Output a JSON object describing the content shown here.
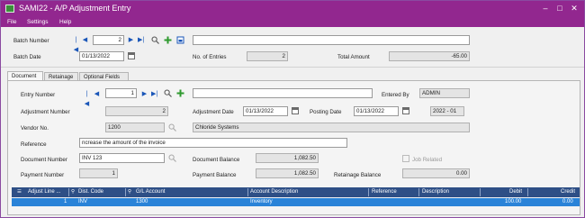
{
  "window": {
    "title": "SAMI22 - A/P Adjustment Entry",
    "controls": [
      "–",
      "□",
      "✕"
    ]
  },
  "menu": [
    "File",
    "Settings",
    "Help"
  ],
  "batch": {
    "number_label": "Batch Number",
    "number_value": "2",
    "date_label": "Batch Date",
    "date_value": "01/13/2022",
    "description_value": "",
    "entries_label": "No. of Entries",
    "entries_value": "2",
    "total_label": "Total Amount",
    "total_value": "-65.00"
  },
  "tabs": [
    "Document",
    "Retainage",
    "Optional Fields"
  ],
  "entry": {
    "entry_number_label": "Entry Number",
    "entry_number_value": "1",
    "entry_description_value": "",
    "entered_by_label": "Entered By",
    "entered_by_value": "ADMIN",
    "adjustment_number_label": "Adjustment Number",
    "adjustment_number_value": "2",
    "adjustment_date_label": "Adjustment Date",
    "adjustment_date_value": "01/13/2022",
    "posting_date_label": "Posting Date",
    "posting_date_value": "01/13/2022",
    "period_value": "2022 - 01",
    "vendor_label": "Vendor No.",
    "vendor_value": "1200",
    "vendor_name_value": "Chloride Systems",
    "reference_label": "Reference",
    "reference_value": "ncrease the amount of the invoice",
    "document_number_label": "Document Number",
    "document_number_value": "INV 123",
    "document_balance_label": "Document Balance",
    "document_balance_value": "1,082.50",
    "job_related_label": "Job Related",
    "payment_number_label": "Payment Number",
    "payment_number_value": "1",
    "payment_balance_label": "Payment Balance",
    "payment_balance_value": "1,082.50",
    "retainage_balance_label": "Retainage Balance",
    "retainage_balance_value": "0.00"
  },
  "grid": {
    "columns": [
      "Adjust Line ...",
      "Dist. Code",
      "G/L Account",
      "Account Description",
      "Reference",
      "Description",
      "Debit",
      "Credit"
    ],
    "rows": [
      {
        "line": "1",
        "dist_code": "INV",
        "gl_account": "1300",
        "account_description": "Inventory",
        "reference": "",
        "description": "",
        "debit": "100.00",
        "credit": "0.00"
      }
    ]
  },
  "colors": {
    "titlebar": "#92278f",
    "grid_header": "#2e4f86",
    "grid_selected": "#2a83d8",
    "nav_blue": "#1a56b8"
  },
  "icons": [
    "app-icon",
    "first-icon",
    "previous-icon",
    "next-icon",
    "last-icon",
    "search-icon",
    "add-icon",
    "settings-icon",
    "calendar-icon"
  ]
}
